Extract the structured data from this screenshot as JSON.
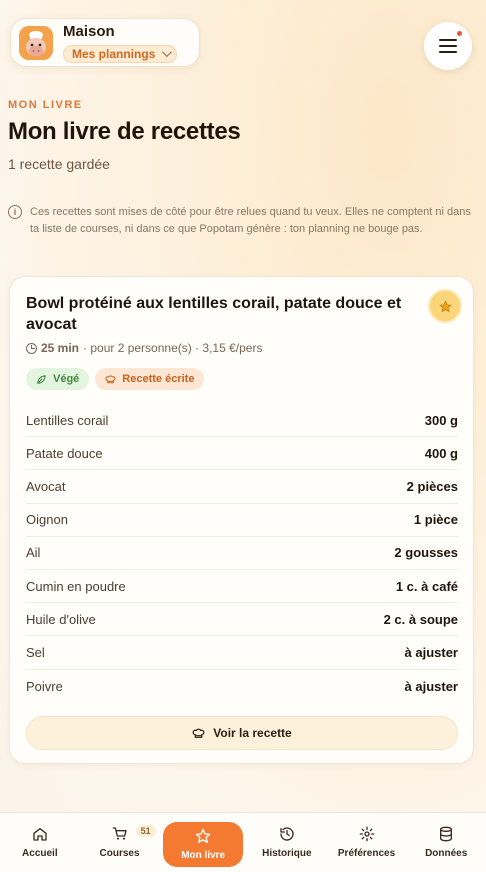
{
  "header": {
    "app_title": "Maison",
    "planning_selector": "Mes plannings"
  },
  "page": {
    "eyebrow": "MON LIVRE",
    "title": "Mon livre de recettes",
    "subtitle": "1 recette gardée",
    "info": "Ces recettes sont mises de côté pour être relues quand tu veux. Elles ne comptent ni dans ta liste de courses, ni dans ce que Popotam génère : ton planning ne bouge pas."
  },
  "recipe": {
    "title": "Bowl protéiné aux lentilles corail, patate douce et avocat",
    "duration": "25 min",
    "meta_rest": "· pour 2 personne(s) · 3,15 €/pers",
    "tags": [
      {
        "label": "Végé"
      },
      {
        "label": "Recette écrite"
      }
    ],
    "ingredients": [
      {
        "name": "Lentilles corail",
        "qty": "300 g"
      },
      {
        "name": "Patate douce",
        "qty": "400 g"
      },
      {
        "name": "Avocat",
        "qty": "2 pièces"
      },
      {
        "name": "Oignon",
        "qty": "1 pièce"
      },
      {
        "name": "Ail",
        "qty": "2 gousses"
      },
      {
        "name": "Cumin en poudre",
        "qty": "1 c. à café"
      },
      {
        "name": "Huile d'olive",
        "qty": "2 c. à soupe"
      },
      {
        "name": "Sel",
        "qty": "à ajuster"
      },
      {
        "name": "Poivre",
        "qty": "à ajuster"
      }
    ],
    "view_button": "Voir la recette"
  },
  "nav": {
    "items": [
      {
        "label": "Accueil",
        "icon": "home-icon"
      },
      {
        "label": "Courses",
        "icon": "cart-icon",
        "badge": "51"
      },
      {
        "label": "Mon livre",
        "icon": "star-icon",
        "active": true
      },
      {
        "label": "Historique",
        "icon": "history-icon"
      },
      {
        "label": "Préférences",
        "icon": "gear-icon"
      },
      {
        "label": "Données",
        "icon": "database-icon"
      }
    ]
  },
  "colors": {
    "accent": "#f47a31",
    "eyebrow": "#e2753a",
    "veg_tag": "#3f8a3b",
    "written_tag": "#c8621d",
    "notification_dot": "#e5533a"
  }
}
